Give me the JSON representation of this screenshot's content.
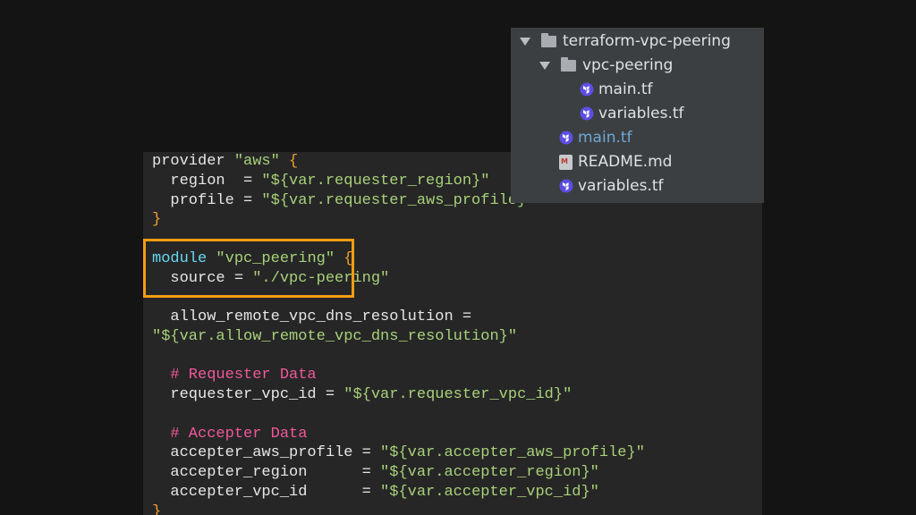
{
  "code": {
    "lines": [
      [
        {
          "t": "provider ",
          "c": "kw"
        },
        {
          "t": "\"aws\"",
          "c": "str"
        },
        {
          "t": " {",
          "c": "brace"
        }
      ],
      [
        {
          "t": "  region  = ",
          "c": "op"
        },
        {
          "t": "\"${var.requester_region}\"",
          "c": "str"
        }
      ],
      [
        {
          "t": "  profile = ",
          "c": "op"
        },
        {
          "t": "\"${var.requester_aws_profile}\"",
          "c": "str"
        }
      ],
      [
        {
          "t": "}",
          "c": "brace"
        }
      ],
      [
        {
          "t": "",
          "c": "op"
        }
      ],
      [
        {
          "t": "module ",
          "c": "mod"
        },
        {
          "t": "\"vpc_peering\"",
          "c": "str"
        },
        {
          "t": " {",
          "c": "brace"
        }
      ],
      [
        {
          "t": "  source = ",
          "c": "op"
        },
        {
          "t": "\"./vpc-peering\"",
          "c": "str"
        }
      ],
      [
        {
          "t": "",
          "c": "op"
        }
      ],
      [
        {
          "t": "  allow_remote_vpc_dns_resolution = ",
          "c": "op"
        }
      ],
      [
        {
          "t": "\"${var.allow_remote_vpc_dns_resolution}\"",
          "c": "str"
        }
      ],
      [
        {
          "t": "",
          "c": "op"
        }
      ],
      [
        {
          "t": "  # Requester Data",
          "c": "cmt"
        }
      ],
      [
        {
          "t": "  requester_vpc_id = ",
          "c": "op"
        },
        {
          "t": "\"${var.requester_vpc_id}\"",
          "c": "str"
        }
      ],
      [
        {
          "t": "",
          "c": "op"
        }
      ],
      [
        {
          "t": "  # Accepter Data",
          "c": "cmt"
        }
      ],
      [
        {
          "t": "  accepter_aws_profile = ",
          "c": "op"
        },
        {
          "t": "\"${var.accepter_aws_profile}\"",
          "c": "str"
        }
      ],
      [
        {
          "t": "  accepter_region      = ",
          "c": "op"
        },
        {
          "t": "\"${var.accepter_region}\"",
          "c": "str"
        }
      ],
      [
        {
          "t": "  accepter_vpc_id      = ",
          "c": "op"
        },
        {
          "t": "\"${var.accepter_vpc_id}\"",
          "c": "str"
        }
      ],
      [
        {
          "t": "}",
          "c": "brace"
        }
      ]
    ]
  },
  "tree": {
    "items": [
      {
        "label": "terraform-vpc-peering",
        "icon": "folder-icon",
        "expanded": true,
        "indent": 0
      },
      {
        "label": "vpc-peering",
        "icon": "folder-icon",
        "expanded": true,
        "indent": 1
      },
      {
        "label": "main.tf",
        "icon": "terraform-file-icon",
        "indent": 2
      },
      {
        "label": "variables.tf",
        "icon": "terraform-file-icon",
        "indent": 2
      },
      {
        "label": "main.tf",
        "icon": "terraform-file-icon",
        "indent": 1,
        "selected": true
      },
      {
        "label": "README.md",
        "icon": "markdown-file-icon",
        "indent": 1
      },
      {
        "label": "variables.tf",
        "icon": "terraform-file-icon",
        "indent": 1
      }
    ]
  },
  "colors": {
    "background": "#141414",
    "code_panel": "#262626",
    "tree_panel": "#3c3f41",
    "highlight": "#f39c12",
    "string": "#a8d17a",
    "module_keyword": "#66d9ef",
    "comment": "#f0589a",
    "terraform_icon": "#7b42bc",
    "selected_file": "#6fa7d6"
  }
}
